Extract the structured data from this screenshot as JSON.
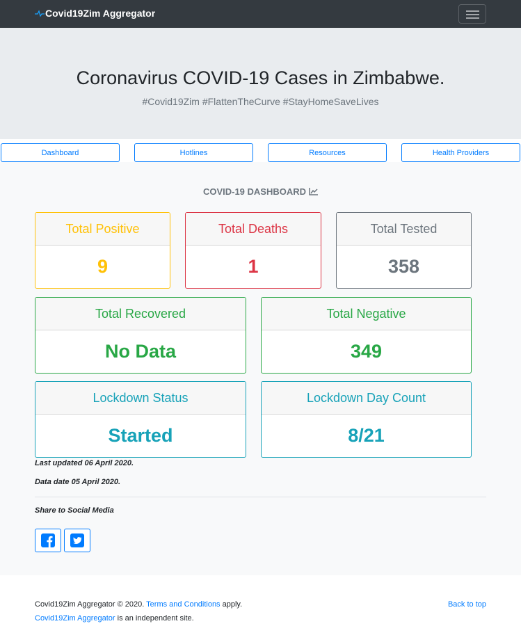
{
  "nav": {
    "brand": "Covid19Zim Aggregator"
  },
  "hero": {
    "title": "Coronavirus COVID-19 Cases in Zimbabwe.",
    "hashtags": "#Covid19Zim #FlattenTheCurve #StayHomeSaveLives"
  },
  "tabs": [
    "Dashboard",
    "Hotlines",
    "Resources",
    "Health Providers"
  ],
  "dashboard": {
    "title": "COVID-19 DASHBOARD",
    "cards": [
      {
        "label": "Total Positive",
        "value": "9",
        "color": "#ffc107"
      },
      {
        "label": "Total Deaths",
        "value": "1",
        "color": "#dc3545"
      },
      {
        "label": "Total Tested",
        "value": "358",
        "color": "#6c757d"
      },
      {
        "label": "Total Recovered",
        "value": "No Data",
        "color": "#28a745"
      },
      {
        "label": "Total Negative",
        "value": "349",
        "color": "#28a745"
      },
      {
        "label": "Lockdown Status",
        "value": "Started",
        "color": "#17a2b8"
      },
      {
        "label": "Lockdown Day Count",
        "value": "8/21",
        "color": "#17a2b8"
      }
    ],
    "last_updated": "Last updated 06 April 2020.",
    "data_date": "Data date 05 April 2020."
  },
  "share": {
    "label": "Share to Social Media",
    "icons": [
      "facebook-icon",
      "twitter-icon"
    ]
  },
  "footer": {
    "copyright": "Covid19Zim Aggregator © 2020.",
    "terms_link": "Terms and Conditions",
    "apply": "apply.",
    "site_link": "Covid19Zim Aggregator",
    "independent": "is an independent site.",
    "back_to_top": "Back to top"
  },
  "colors": {
    "navbar": "#343a40",
    "hero": "#e9ecef",
    "link": "#007bff"
  }
}
